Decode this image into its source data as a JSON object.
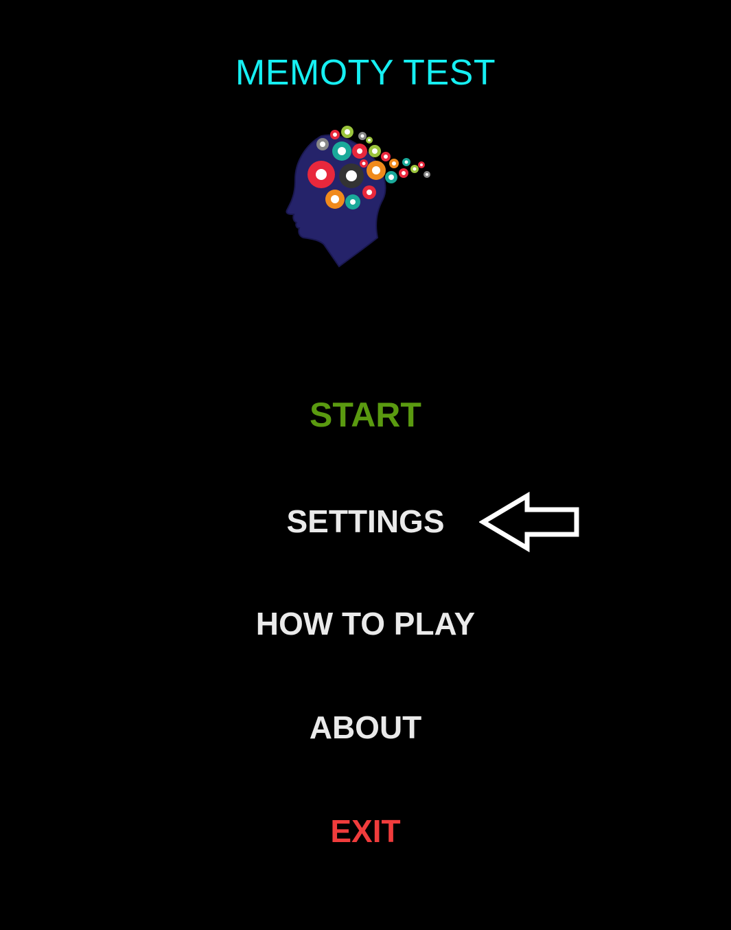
{
  "app": {
    "title": "MEMOTY TEST"
  },
  "logo": {
    "icon": "brain-gears-head-icon"
  },
  "menu": {
    "start": "START",
    "settings": "SETTINGS",
    "how_to_play": "HOW TO PLAY",
    "about": "ABOUT",
    "exit": "EXIT"
  },
  "pointer": {
    "icon": "left-arrow-icon",
    "target": "SETTINGS"
  },
  "colors": {
    "background": "#000000",
    "title": "#16EFF2",
    "start": "#5A9A10",
    "menu_default": "#EAEAEA",
    "exit": "#F03C3C",
    "head": "#25236A"
  }
}
